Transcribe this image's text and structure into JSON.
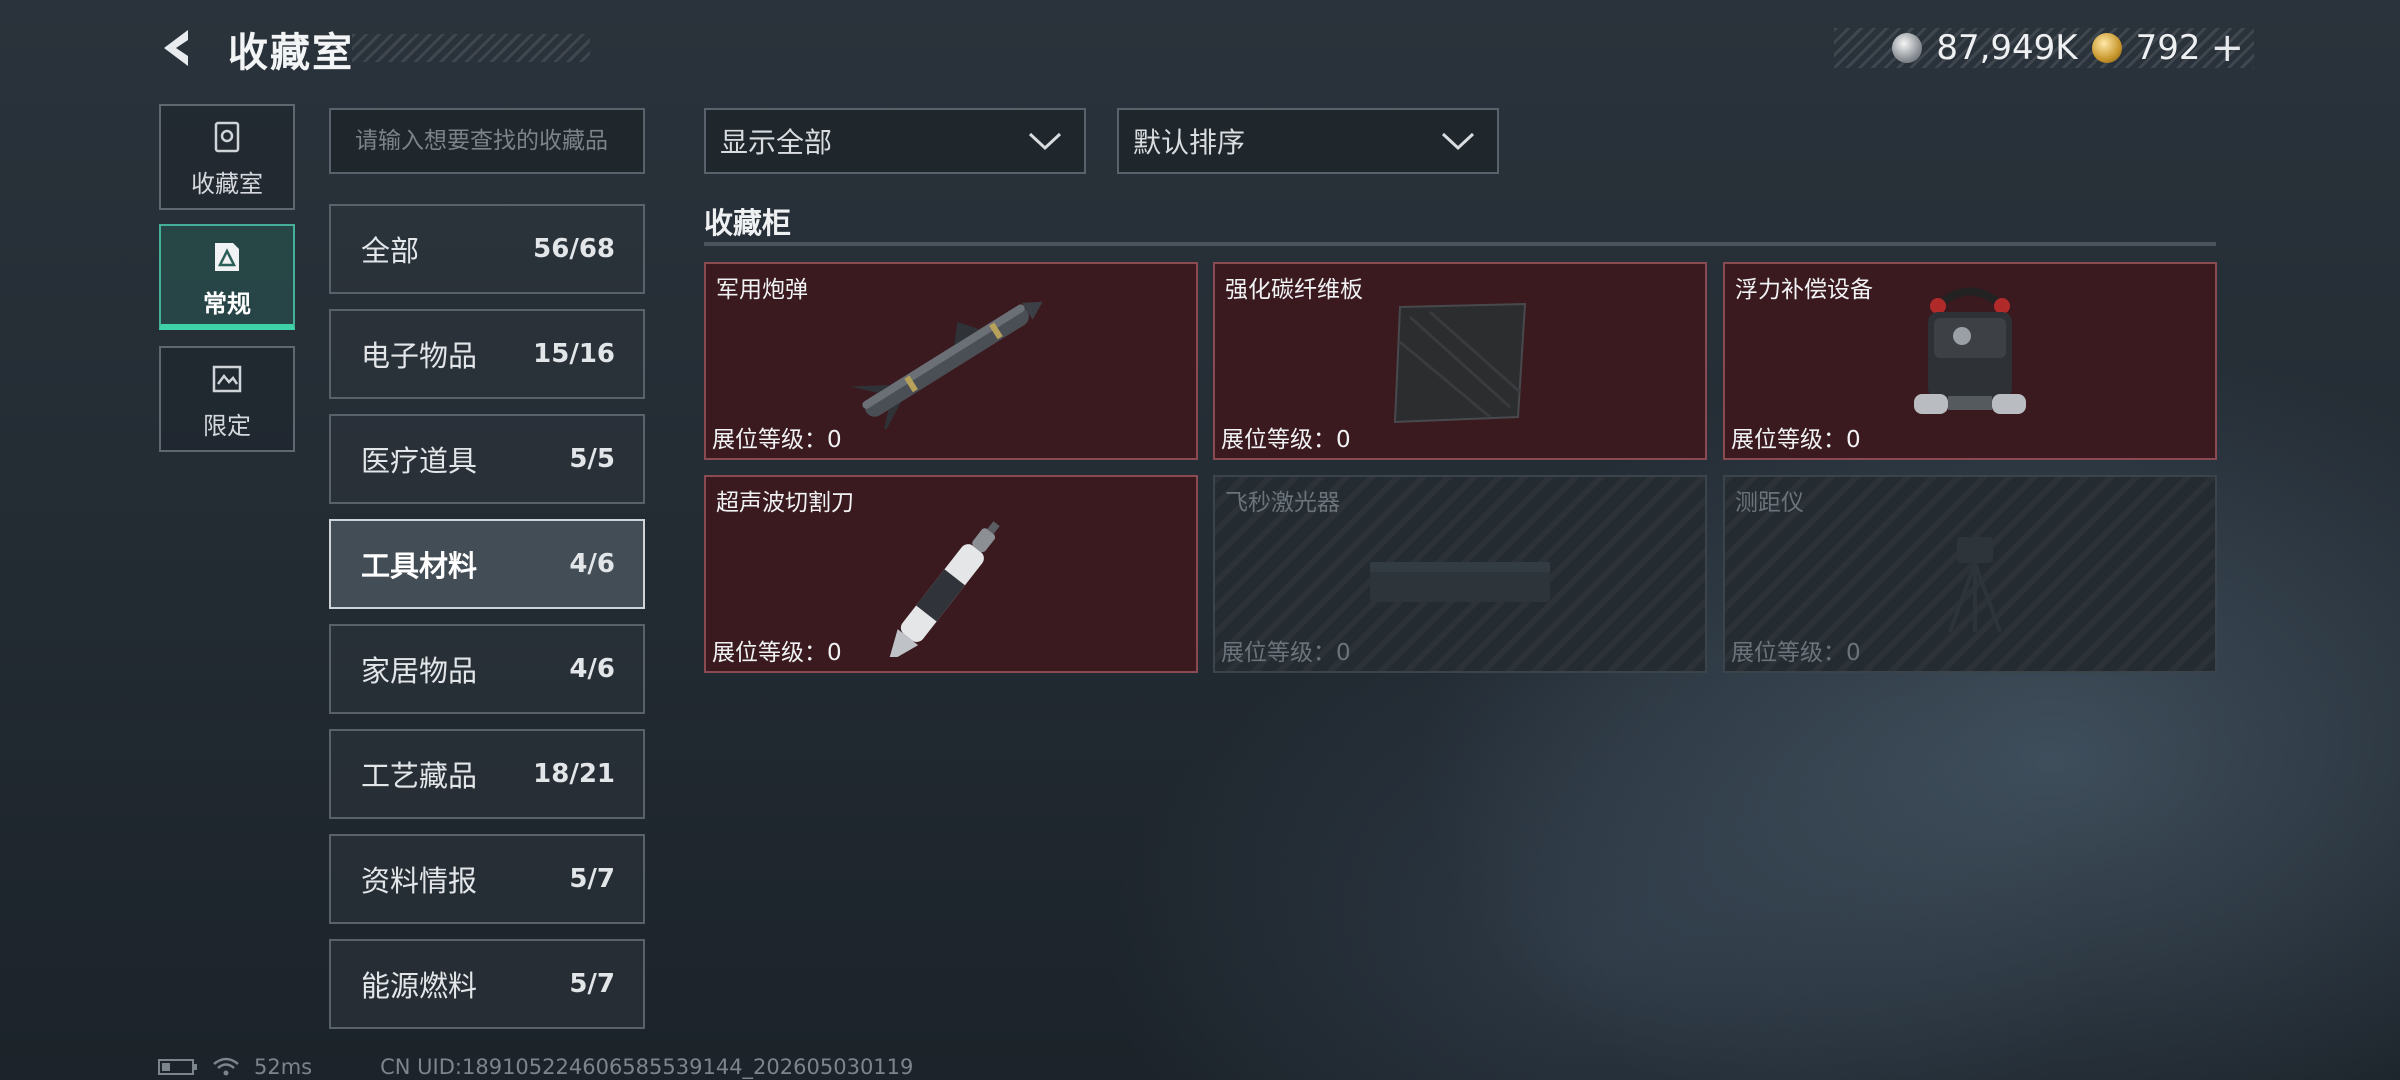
{
  "header": {
    "title": "收藏室",
    "currency_silver": "87,949K",
    "currency_gold": "792",
    "plus_label": "+"
  },
  "rail": [
    {
      "label": "收藏室",
      "icon": "collection-icon"
    },
    {
      "label": "常规",
      "icon": "regular-icon"
    },
    {
      "label": "限定",
      "icon": "limited-icon"
    }
  ],
  "search": {
    "placeholder": "请输入想要查找的收藏品",
    "value": ""
  },
  "categories": [
    {
      "name": "全部",
      "count": "56/68"
    },
    {
      "name": "电子物品",
      "count": "15/16"
    },
    {
      "name": "医疗道具",
      "count": "5/5"
    },
    {
      "name": "工具材料",
      "count": "4/6"
    },
    {
      "name": "家居物品",
      "count": "4/6"
    },
    {
      "name": "工艺藏品",
      "count": "18/21"
    },
    {
      "name": "资料情报",
      "count": "5/7"
    },
    {
      "name": "能源燃料",
      "count": "5/7"
    }
  ],
  "filters": {
    "display": "显示全部",
    "sort": "默认排序"
  },
  "section_title": "收藏柜",
  "items": [
    {
      "name": "军用炮弹",
      "level": "展位等级：0",
      "owned": true,
      "icon": "missile-icon"
    },
    {
      "name": "强化碳纤维板",
      "level": "展位等级：0",
      "owned": true,
      "icon": "carbon-plate-icon"
    },
    {
      "name": "浮力补偿设备",
      "level": "展位等级：0",
      "owned": true,
      "icon": "buoyancy-device-icon"
    },
    {
      "name": "超声波切割刀",
      "level": "展位等级：0",
      "owned": true,
      "icon": "ultrasonic-knife-icon"
    },
    {
      "name": "飞秒激光器",
      "level": "展位等级：0",
      "owned": false,
      "icon": "laser-icon"
    },
    {
      "name": "测距仪",
      "level": "展位等级：0",
      "owned": false,
      "icon": "rangefinder-icon"
    }
  ],
  "footer": {
    "ping": "52ms",
    "uid": "CN UID:18910522460658553914​4_202605030119"
  },
  "colors": {
    "owned_card": "#3a1a1f",
    "accent": "#3fd1a8",
    "locked_card": "#242b31"
  }
}
